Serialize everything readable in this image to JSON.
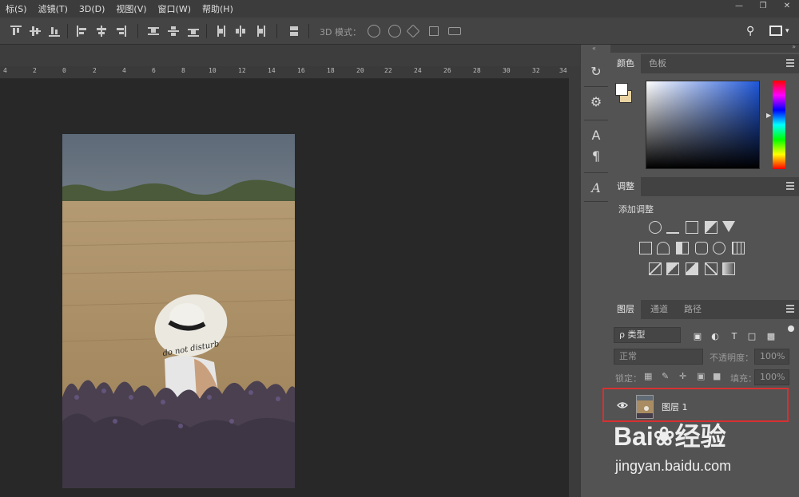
{
  "menubar": {
    "items": [
      "标(S)",
      "滤镜(T)",
      "3D(D)",
      "视图(V)",
      "窗口(W)",
      "帮助(H)"
    ]
  },
  "optionsbar": {
    "mode3d_label": "3D 模式："
  },
  "ruler": {
    "labels": [
      "4",
      "2",
      "0",
      "2",
      "4",
      "6",
      "8",
      "10",
      "12",
      "14",
      "16",
      "18",
      "20",
      "22",
      "24",
      "26",
      "28",
      "30",
      "32",
      "34"
    ]
  },
  "panels": {
    "color": {
      "tabs": [
        "颜色",
        "色板"
      ],
      "foreground": "#ffffff",
      "background": "#e9d3a2"
    },
    "adjustments": {
      "tab": "调整",
      "title": "添加调整"
    },
    "layers": {
      "tabs": [
        "图层",
        "通道",
        "路径"
      ],
      "filter_label": "ρ 类型",
      "blend_mode": "正常",
      "opacity_label": "不透明度：",
      "opacity_value": "100%",
      "lock_label": "锁定：",
      "fill_label": "填充：",
      "fill_value": "100%",
      "layer_name": "图层 1"
    }
  },
  "watermark": {
    "brand": "Bai❀经验",
    "url": "jingyan.baidu.com"
  },
  "photo": {
    "hat_text": "do not disturb"
  }
}
